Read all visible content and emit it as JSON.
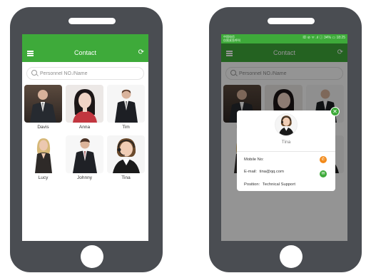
{
  "status": {
    "carrier_line1": "中国电信",
    "carrier_line2": "仅限紧急呼叫",
    "indicators": "ID ⊘ ᯤ .ıl ⓘ 34% ▭ 18:25"
  },
  "app": {
    "title": "Contact"
  },
  "search": {
    "placeholder": "Personnel NO./Name"
  },
  "contacts": [
    {
      "name": "Davis"
    },
    {
      "name": "Anna"
    },
    {
      "name": "Tim"
    },
    {
      "name": "Lucy"
    },
    {
      "name": "Johnny"
    },
    {
      "name": "Tina"
    }
  ],
  "popup": {
    "name": "Tina",
    "mobile_label": "Mobile No:",
    "email_label": "E-mail:",
    "email_value": "tina@qq.com",
    "position_label": "Position:",
    "position_value": "Technical Support"
  },
  "icons": {
    "menu": "menu-icon",
    "refresh": "refresh-icon",
    "search": "search-icon",
    "phone": "phone-icon",
    "mail": "mail-icon",
    "close": "close-icon"
  },
  "colors": {
    "accent": "#3eaa3a",
    "phone_body": "#4a4d52",
    "phone_button": "#f28a1a",
    "mail_button": "#3eaa3a"
  }
}
